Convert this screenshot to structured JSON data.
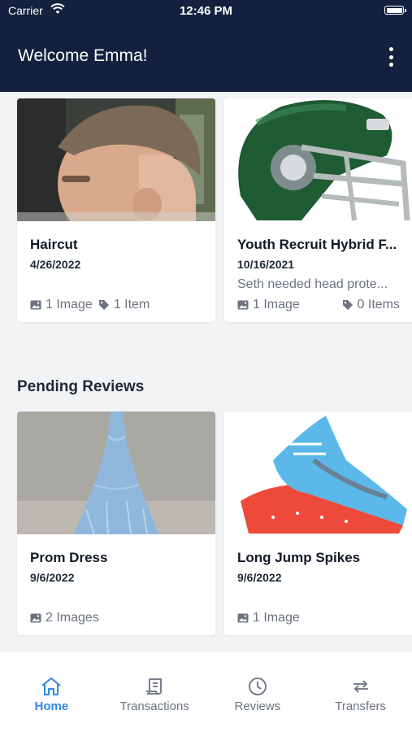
{
  "status_bar": {
    "carrier": "Carrier",
    "time": "12:46 PM"
  },
  "header": {
    "title": "Welcome Emma!"
  },
  "recent_cards": [
    {
      "name": "Haircut",
      "date": "4/26/2022",
      "description": "",
      "images_label": "1 Image",
      "items_label": "1 Item"
    },
    {
      "name": "Youth Recruit Hybrid F...",
      "date": "10/16/2021",
      "description": "Seth needed head prote...",
      "images_label": "1 Image",
      "items_label": "0 Items"
    }
  ],
  "pending_reviews": {
    "title": "Pending Reviews",
    "cards": [
      {
        "name": "Prom Dress",
        "date": "9/6/2022",
        "images_label": "2 Images"
      },
      {
        "name": "Long Jump Spikes",
        "date": "9/6/2022",
        "images_label": "1 Image"
      }
    ]
  },
  "tabs": [
    {
      "label": "Home",
      "icon": "home-icon",
      "active": true
    },
    {
      "label": "Transactions",
      "icon": "receipt-icon",
      "active": false
    },
    {
      "label": "Reviews",
      "icon": "clock-icon",
      "active": false
    },
    {
      "label": "Transfers",
      "icon": "transfer-arrows-icon",
      "active": false
    }
  ],
  "colors": {
    "header_bg": "#13213f",
    "accent": "#2f86e8",
    "background": "#f2f3f5"
  }
}
